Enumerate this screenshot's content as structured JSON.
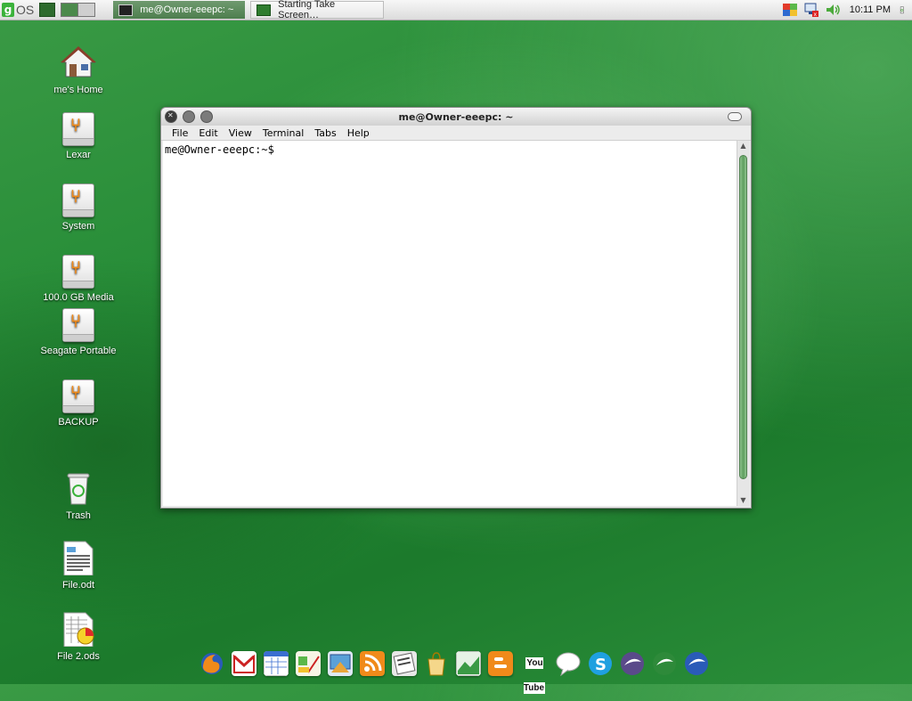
{
  "top_panel": {
    "logo_g": "g",
    "logo_text": "OS",
    "tasks": [
      {
        "label": "me@Owner-eeepc: ~"
      },
      {
        "label": "Starting Take Screen…"
      }
    ],
    "clock": "10:11 PM"
  },
  "desktop_icons": [
    {
      "label": "me's Home",
      "icon": "home-icon"
    },
    {
      "label": "Lexar",
      "icon": "usb-drive-icon"
    },
    {
      "label": "System",
      "icon": "usb-drive-icon"
    },
    {
      "label": "100.0 GB Media",
      "icon": "usb-drive-icon"
    },
    {
      "label": "Seagate Portable",
      "icon": "usb-drive-icon"
    },
    {
      "label": "BACKUP",
      "icon": "usb-drive-icon"
    },
    {
      "label": "Trash",
      "icon": "trash-icon"
    },
    {
      "label": "File.odt",
      "icon": "document-icon"
    },
    {
      "label": "File 2.ods",
      "icon": "spreadsheet-icon"
    }
  ],
  "terminal": {
    "title": "me@Owner-eeepc: ~",
    "menu": [
      "File",
      "Edit",
      "View",
      "Terminal",
      "Tabs",
      "Help"
    ],
    "prompt": "me@Owner-eeepc:~$"
  },
  "dock": {
    "youtube_text": "You Tube",
    "icons": [
      "firefox-icon",
      "gmail-icon",
      "calendar-icon",
      "docs-icon",
      "photos-icon",
      "rss-icon",
      "news-icon",
      "shopping-icon",
      "maps-icon",
      "blogger-icon",
      "youtube-icon",
      "chat-icon",
      "skype-icon",
      "openoffice-icon",
      "openoffice-calc-icon",
      "openoffice-impress-icon"
    ]
  },
  "colors": {
    "desktop_green": "#238a35",
    "accent_green": "#3bb23b",
    "usb_orange": "#f08a1a"
  }
}
